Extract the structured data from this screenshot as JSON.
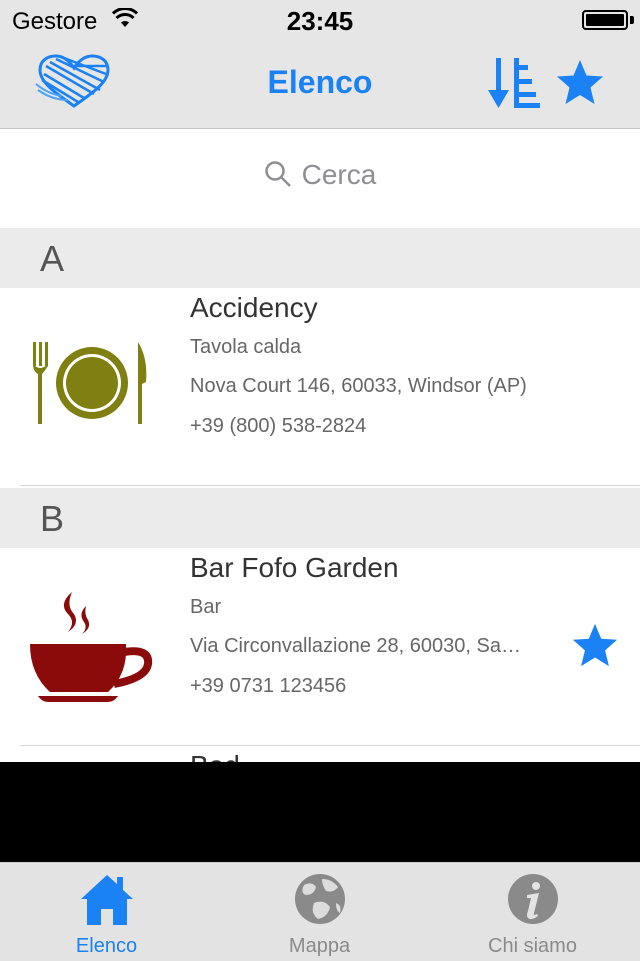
{
  "status_bar": {
    "carrier": "Gestore",
    "time": "23:45"
  },
  "nav": {
    "title": "Elenco",
    "accent_color": "#1a82f5"
  },
  "search": {
    "placeholder": "Cerca"
  },
  "sections": [
    {
      "letter": "A",
      "items": [
        {
          "name": "Accidency",
          "category": "Tavola calda",
          "address": "Nova Court 146, 60033, Windsor (AP)",
          "phone": "+39 (800) 538-2824",
          "icon": "restaurant-plate-icon",
          "favorite": false
        }
      ]
    },
    {
      "letter": "B",
      "items": [
        {
          "name": "Bar Fofo Garden",
          "category": "Bar",
          "address": "Via Circonvallazione 28, 60030, Sa…",
          "phone": "+39 0731 123456",
          "icon": "coffee-cup-icon",
          "favorite": true
        },
        {
          "name": "Bad",
          "partially_visible": true
        }
      ]
    }
  ],
  "tabs": [
    {
      "label": "Elenco",
      "icon": "home-icon",
      "active": true
    },
    {
      "label": "Mappa",
      "icon": "globe-icon",
      "active": false
    },
    {
      "label": "Chi siamo",
      "icon": "info-icon",
      "active": false
    }
  ]
}
